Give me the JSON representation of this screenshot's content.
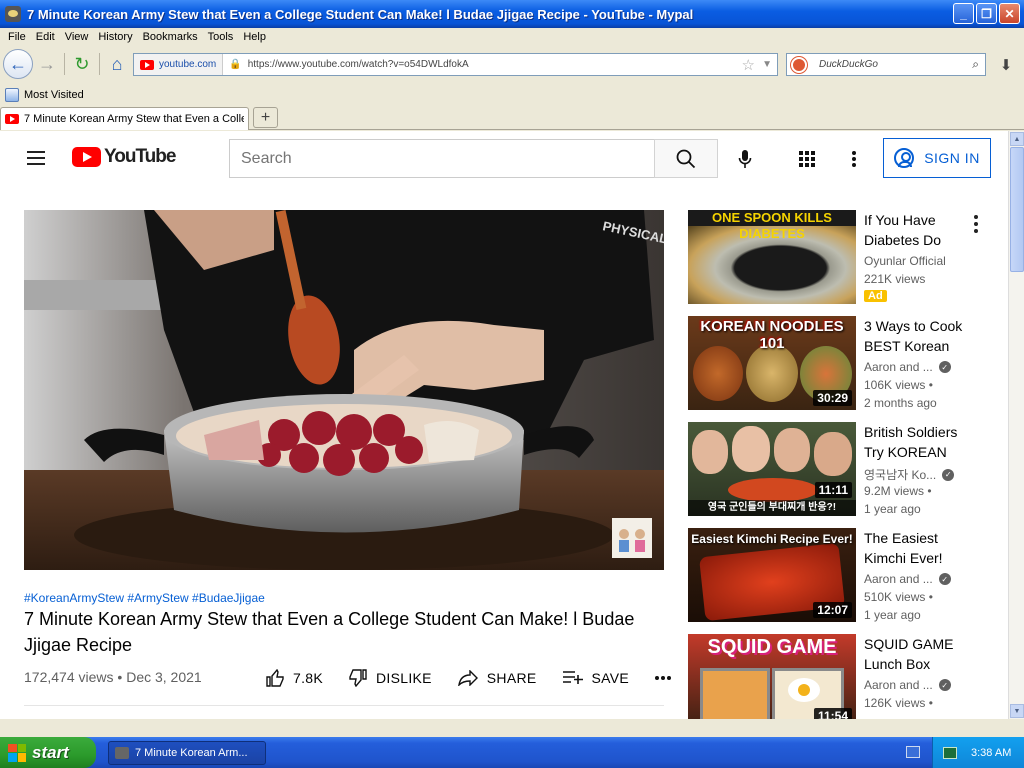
{
  "window": {
    "title": "7 Minute Korean Army Stew that Even a College Student Can Make! l Budae Jjigae Recipe - YouTube - Mypal"
  },
  "menu": [
    "File",
    "Edit",
    "View",
    "History",
    "Bookmarks",
    "Tools",
    "Help"
  ],
  "nav": {
    "site": "youtube.com",
    "url": "https://www.youtube.com/watch?v=o54DWLdfokA",
    "search_placeholder": "DuckDuckGo"
  },
  "bookmarks": {
    "most_visited": "Most Visited"
  },
  "tab": {
    "label": "7 Minute Korean Army Stew that Even a College Student Can Make! l Budae Jjigae Recipe - YouTube"
  },
  "yt": {
    "logo": "YouTube",
    "search_placeholder": "Search",
    "sign_in": "SIGN IN"
  },
  "video": {
    "hashtags": "#KoreanArmyStew #ArmyStew #BudaeJjigae",
    "title": "7 Minute Korean Army Stew that Even a College Student Can Make! l Budae Jjigae Recipe",
    "views": "172,474 views",
    "date": "Dec 3, 2021",
    "likes": "7.8K",
    "dislike": "DISLIKE",
    "share": "SHARE",
    "save": "SAVE"
  },
  "recommendations": [
    {
      "thumb_text": "ONE SPOON KILLS DIABETES",
      "title": "If You Have Diabetes Do",
      "channel": "Oyunlar Official",
      "views": "221K views",
      "badge": "Ad",
      "duration": ""
    },
    {
      "thumb_text": "KOREAN NOODLES 101",
      "title": "3 Ways to Cook BEST Korean",
      "channel": "Aaron and ...",
      "views": "106K views •",
      "age": "2 months ago",
      "duration": "30:29"
    },
    {
      "thumb_text": "영국 군인들의 부대찌개 반응?!",
      "title": "British Soldiers Try KOREAN",
      "channel": "영국남자 Ko...",
      "views": "9.2M views •",
      "age": "1 year ago",
      "duration": "11:11"
    },
    {
      "thumb_text": "Easiest Kimchi Recipe Ever!",
      "title": "The Easiest Kimchi Ever!",
      "channel": "Aaron and ...",
      "views": "510K views •",
      "age": "1 year ago",
      "duration": "12:07"
    },
    {
      "thumb_text": "SQUID GAME",
      "title": "SQUID GAME Lunch Box",
      "channel": "Aaron and ...",
      "views": "126K views •",
      "age": "",
      "duration": "11:54"
    }
  ],
  "taskbar": {
    "start": "start",
    "item": "7 Minute Korean Arm...",
    "clock": "3:38 AM"
  }
}
